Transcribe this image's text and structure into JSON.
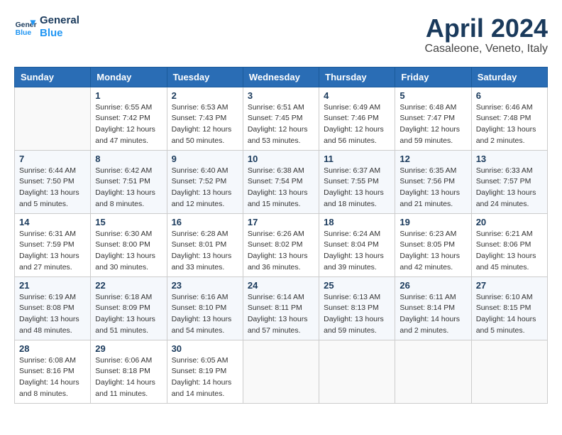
{
  "header": {
    "logo_line1": "General",
    "logo_line2": "Blue",
    "month": "April 2024",
    "location": "Casaleone, Veneto, Italy"
  },
  "weekdays": [
    "Sunday",
    "Monday",
    "Tuesday",
    "Wednesday",
    "Thursday",
    "Friday",
    "Saturday"
  ],
  "weeks": [
    [
      {
        "day": "",
        "info": ""
      },
      {
        "day": "1",
        "info": "Sunrise: 6:55 AM\nSunset: 7:42 PM\nDaylight: 12 hours\nand 47 minutes."
      },
      {
        "day": "2",
        "info": "Sunrise: 6:53 AM\nSunset: 7:43 PM\nDaylight: 12 hours\nand 50 minutes."
      },
      {
        "day": "3",
        "info": "Sunrise: 6:51 AM\nSunset: 7:45 PM\nDaylight: 12 hours\nand 53 minutes."
      },
      {
        "day": "4",
        "info": "Sunrise: 6:49 AM\nSunset: 7:46 PM\nDaylight: 12 hours\nand 56 minutes."
      },
      {
        "day": "5",
        "info": "Sunrise: 6:48 AM\nSunset: 7:47 PM\nDaylight: 12 hours\nand 59 minutes."
      },
      {
        "day": "6",
        "info": "Sunrise: 6:46 AM\nSunset: 7:48 PM\nDaylight: 13 hours\nand 2 minutes."
      }
    ],
    [
      {
        "day": "7",
        "info": "Sunrise: 6:44 AM\nSunset: 7:50 PM\nDaylight: 13 hours\nand 5 minutes."
      },
      {
        "day": "8",
        "info": "Sunrise: 6:42 AM\nSunset: 7:51 PM\nDaylight: 13 hours\nand 8 minutes."
      },
      {
        "day": "9",
        "info": "Sunrise: 6:40 AM\nSunset: 7:52 PM\nDaylight: 13 hours\nand 12 minutes."
      },
      {
        "day": "10",
        "info": "Sunrise: 6:38 AM\nSunset: 7:54 PM\nDaylight: 13 hours\nand 15 minutes."
      },
      {
        "day": "11",
        "info": "Sunrise: 6:37 AM\nSunset: 7:55 PM\nDaylight: 13 hours\nand 18 minutes."
      },
      {
        "day": "12",
        "info": "Sunrise: 6:35 AM\nSunset: 7:56 PM\nDaylight: 13 hours\nand 21 minutes."
      },
      {
        "day": "13",
        "info": "Sunrise: 6:33 AM\nSunset: 7:57 PM\nDaylight: 13 hours\nand 24 minutes."
      }
    ],
    [
      {
        "day": "14",
        "info": "Sunrise: 6:31 AM\nSunset: 7:59 PM\nDaylight: 13 hours\nand 27 minutes."
      },
      {
        "day": "15",
        "info": "Sunrise: 6:30 AM\nSunset: 8:00 PM\nDaylight: 13 hours\nand 30 minutes."
      },
      {
        "day": "16",
        "info": "Sunrise: 6:28 AM\nSunset: 8:01 PM\nDaylight: 13 hours\nand 33 minutes."
      },
      {
        "day": "17",
        "info": "Sunrise: 6:26 AM\nSunset: 8:02 PM\nDaylight: 13 hours\nand 36 minutes."
      },
      {
        "day": "18",
        "info": "Sunrise: 6:24 AM\nSunset: 8:04 PM\nDaylight: 13 hours\nand 39 minutes."
      },
      {
        "day": "19",
        "info": "Sunrise: 6:23 AM\nSunset: 8:05 PM\nDaylight: 13 hours\nand 42 minutes."
      },
      {
        "day": "20",
        "info": "Sunrise: 6:21 AM\nSunset: 8:06 PM\nDaylight: 13 hours\nand 45 minutes."
      }
    ],
    [
      {
        "day": "21",
        "info": "Sunrise: 6:19 AM\nSunset: 8:08 PM\nDaylight: 13 hours\nand 48 minutes."
      },
      {
        "day": "22",
        "info": "Sunrise: 6:18 AM\nSunset: 8:09 PM\nDaylight: 13 hours\nand 51 minutes."
      },
      {
        "day": "23",
        "info": "Sunrise: 6:16 AM\nSunset: 8:10 PM\nDaylight: 13 hours\nand 54 minutes."
      },
      {
        "day": "24",
        "info": "Sunrise: 6:14 AM\nSunset: 8:11 PM\nDaylight: 13 hours\nand 57 minutes."
      },
      {
        "day": "25",
        "info": "Sunrise: 6:13 AM\nSunset: 8:13 PM\nDaylight: 13 hours\nand 59 minutes."
      },
      {
        "day": "26",
        "info": "Sunrise: 6:11 AM\nSunset: 8:14 PM\nDaylight: 14 hours\nand 2 minutes."
      },
      {
        "day": "27",
        "info": "Sunrise: 6:10 AM\nSunset: 8:15 PM\nDaylight: 14 hours\nand 5 minutes."
      }
    ],
    [
      {
        "day": "28",
        "info": "Sunrise: 6:08 AM\nSunset: 8:16 PM\nDaylight: 14 hours\nand 8 minutes."
      },
      {
        "day": "29",
        "info": "Sunrise: 6:06 AM\nSunset: 8:18 PM\nDaylight: 14 hours\nand 11 minutes."
      },
      {
        "day": "30",
        "info": "Sunrise: 6:05 AM\nSunset: 8:19 PM\nDaylight: 14 hours\nand 14 minutes."
      },
      {
        "day": "",
        "info": ""
      },
      {
        "day": "",
        "info": ""
      },
      {
        "day": "",
        "info": ""
      },
      {
        "day": "",
        "info": ""
      }
    ]
  ]
}
